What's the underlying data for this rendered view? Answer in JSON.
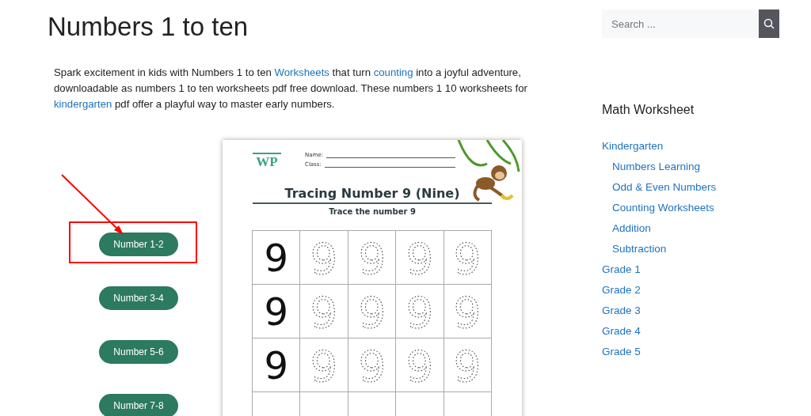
{
  "page_title": "Numbers 1 to ten",
  "intro": [
    {
      "text": "Spark excitement in kids with Numbers 1 to ten ",
      "link": false
    },
    {
      "text": "Worksheets",
      "link": true
    },
    {
      "text": " that turn ",
      "link": false
    },
    {
      "text": "counting",
      "link": true
    },
    {
      "text": " into a joyful adventure, downloadable as numbers 1 to ten worksheets pdf free download. These numbers 1 10 worksheets for ",
      "link": false
    },
    {
      "text": "kindergarten",
      "link": true
    },
    {
      "text": " pdf offer a playful way to master early numbers.",
      "link": false
    }
  ],
  "range_buttons": [
    {
      "label": "Number 1-2",
      "highlighted": true
    },
    {
      "label": "Number 3-4",
      "highlighted": false
    },
    {
      "label": "Number 5-6",
      "highlighted": false
    },
    {
      "label": "Number 7-8",
      "highlighted": false
    }
  ],
  "worksheet": {
    "logo": "WP",
    "name_label": "Name:",
    "class_label": "Class:",
    "title": "Tracing Number 9 (Nine)",
    "subtitle": "Trace the number 9",
    "rows": [
      {
        "model": "9",
        "traces": [
          "9",
          "9",
          "9",
          "9"
        ]
      },
      {
        "model": "9",
        "traces": [
          "9",
          "9",
          "9",
          "9"
        ]
      },
      {
        "model": "9",
        "traces": [
          "9",
          "9",
          "9",
          "9"
        ]
      }
    ]
  },
  "search": {
    "placeholder": "Search ..."
  },
  "sidebar": {
    "heading": "Math Worksheet",
    "items": [
      {
        "label": "Kindergarten",
        "children": [
          {
            "label": "Numbers Learning"
          },
          {
            "label": "Odd & Even Numbers"
          },
          {
            "label": "Counting Worksheets"
          },
          {
            "label": "Addition"
          },
          {
            "label": "Subtraction"
          }
        ]
      },
      {
        "label": "Grade 1"
      },
      {
        "label": "Grade 2"
      },
      {
        "label": "Grade 3"
      },
      {
        "label": "Grade 4"
      },
      {
        "label": "Grade 5"
      }
    ]
  }
}
